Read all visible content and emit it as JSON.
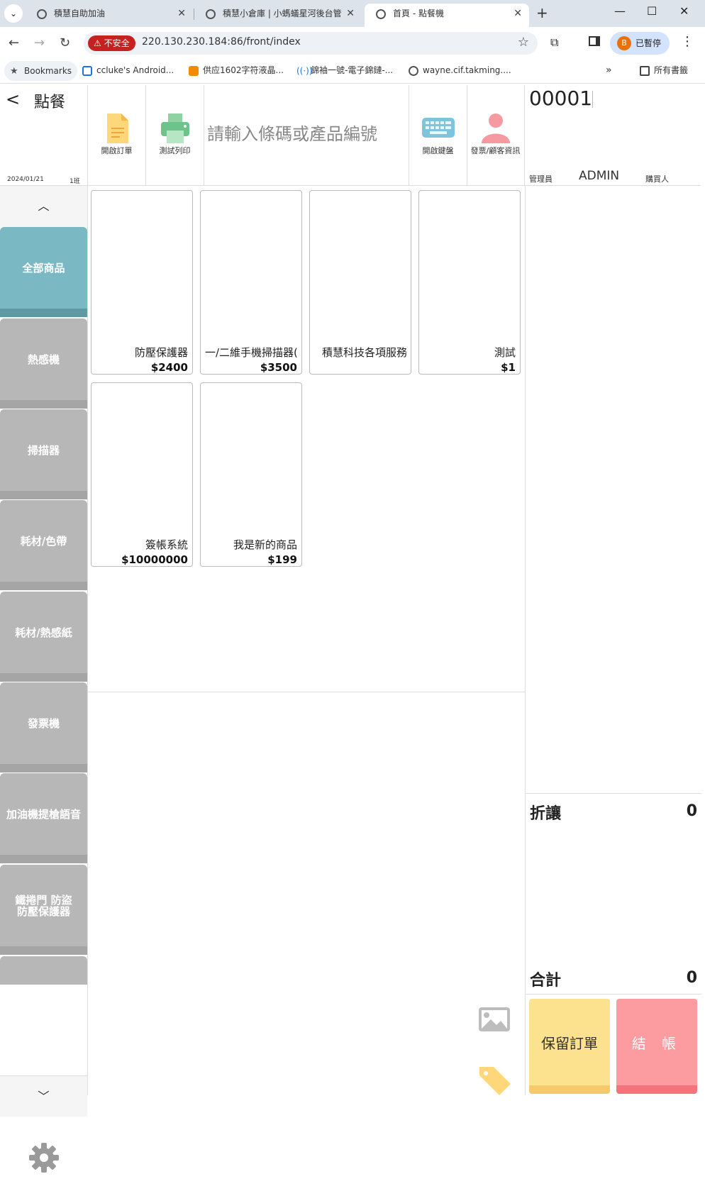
{
  "browser": {
    "tabs": [
      {
        "title": "積慧自助加油"
      },
      {
        "title": "積慧小倉庫 | 小螞蟻星河後台管"
      },
      {
        "title": "首頁 - 點餐機"
      }
    ],
    "insecure_label": "不安全",
    "url": "220.130.230.184:86/front/index",
    "profile_label": "已暫停",
    "profile_initial": "B",
    "bookmarks": [
      {
        "label": "Bookmarks"
      },
      {
        "label": "ccluke's Android..."
      },
      {
        "label": "供应1602字符液晶..."
      },
      {
        "label": "錦袖一號-電子錦鏈-..."
      },
      {
        "label": "wayne.cif.takming...."
      }
    ],
    "all_bookmarks_label": "所有書籤"
  },
  "header": {
    "title": "點餐",
    "date": "2024/01/21",
    "shift": "1班",
    "buttons": [
      {
        "label": "開啟訂單"
      },
      {
        "label": "測試列印"
      },
      {
        "label": "開啟鍵盤"
      },
      {
        "label": "發票/顧客資訊"
      }
    ],
    "search_placeholder": "請輸入條碼或產品編號"
  },
  "order": {
    "number": "00001",
    "admin_label": "管理員",
    "admin_value": "ADMIN",
    "buyer_label": "購買人"
  },
  "categories": [
    {
      "label": "全部商品",
      "active": true
    },
    {
      "label": "熱感機"
    },
    {
      "label": "掃描器"
    },
    {
      "label": "耗材/色帶"
    },
    {
      "label": "耗材/熱感紙"
    },
    {
      "label": "發票機"
    },
    {
      "label": "加油機提槍語音"
    },
    {
      "label": "鐵捲門 防盜 防壓保護器"
    }
  ],
  "products": [
    {
      "name": "防壓保護器",
      "price": "$2400"
    },
    {
      "name": "一/二維手機掃描器(",
      "price": "$3500"
    },
    {
      "name": "積慧科技各項服務",
      "price": ""
    },
    {
      "name": "測試",
      "price": "$1"
    },
    {
      "name": "簽帳系統",
      "price": "$10000000"
    },
    {
      "name": "我是新的商品",
      "price": "$199"
    }
  ],
  "summary": {
    "discount_label": "折讓",
    "discount_value": "0",
    "total_label": "合計",
    "total_value": "0",
    "hold_label": "保留訂單",
    "checkout_label": "結 帳"
  },
  "colors": {
    "active_category": "#7ab8c3",
    "category": "#b7b7b7",
    "hold_button": "#fce28e",
    "checkout_button": "#fc9ba0",
    "insecure": "#c5221f"
  }
}
